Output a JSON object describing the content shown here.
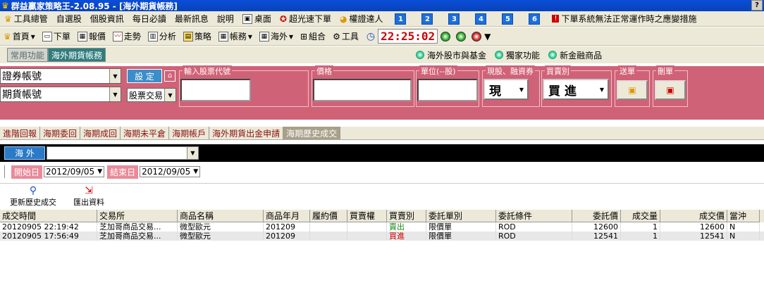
{
  "window": {
    "title": "群益贏家策略王-2.08.95 - [海外期貨帳務]",
    "help": "?"
  },
  "menu": {
    "items": [
      "工具總管",
      "自選股",
      "個股資訊",
      "每日必讀",
      "最新訊息",
      "說明",
      "桌面",
      "超光速下單",
      "權證達人"
    ],
    "numbers": [
      "1",
      "2",
      "3",
      "4",
      "5",
      "6"
    ],
    "warning": "下單系統無法正常運作時之應變措施"
  },
  "toolbar": {
    "items": [
      "首頁",
      "下單",
      "報價",
      "走勢",
      "分析",
      "策略",
      "帳務",
      "海外",
      "組合",
      "工具"
    ],
    "clock": "22:25:02"
  },
  "tabs1": {
    "common": "常用功能",
    "overseas": "海外期貨帳務",
    "links": [
      "海外股市與基金",
      "獨家功能",
      "新金融商品"
    ]
  },
  "order": {
    "account1": "證券帳號",
    "account2": "期貨帳號",
    "set": "設 定",
    "trade_type": "股票交易",
    "input_code": "輸入股票代號",
    "price": "價格",
    "unit": "單位(--股)",
    "mode_label": "現股、融資券",
    "mode": "現",
    "side_label": "買賣別",
    "side": "買 進",
    "send": "送單",
    "cancel": "刪單"
  },
  "tabs2": [
    "進階回報",
    "海期委回",
    "海期成回",
    "海期未平倉",
    "海期帳戶",
    "海外期貨出金申請",
    "海期歷史成交"
  ],
  "market": {
    "label": "海 外"
  },
  "dates": {
    "start_label": "開始日",
    "start": "2012/09/05",
    "end_label": "結束日",
    "end": "2012/09/05"
  },
  "actions": {
    "refresh": "更新歷史成交",
    "export": "匯出資料"
  },
  "table": {
    "headers": [
      "成交時間",
      "交易所",
      "商品名稱",
      "商品年月",
      "履約價",
      "買賣權",
      "買賣別",
      "委託單別",
      "委託條件",
      "委託價",
      "成交量",
      "成交價",
      "當沖"
    ],
    "rows": [
      [
        "20120905 22:19:42",
        "芝加哥商品交易...",
        "微型歐元",
        "201209",
        "",
        "",
        "賣出",
        "限價單",
        "ROD",
        "12600",
        "1",
        "12600",
        "N"
      ],
      [
        "20120905 17:56:49",
        "芝加哥商品交易...",
        "微型歐元",
        "201209",
        "",
        "",
        "買進",
        "限價單",
        "ROD",
        "12541",
        "1",
        "12541",
        "N"
      ]
    ]
  },
  "colors": {
    "title": "#0842b8",
    "panel": "#d06277",
    "tab_sel": "#2f7d7d"
  }
}
